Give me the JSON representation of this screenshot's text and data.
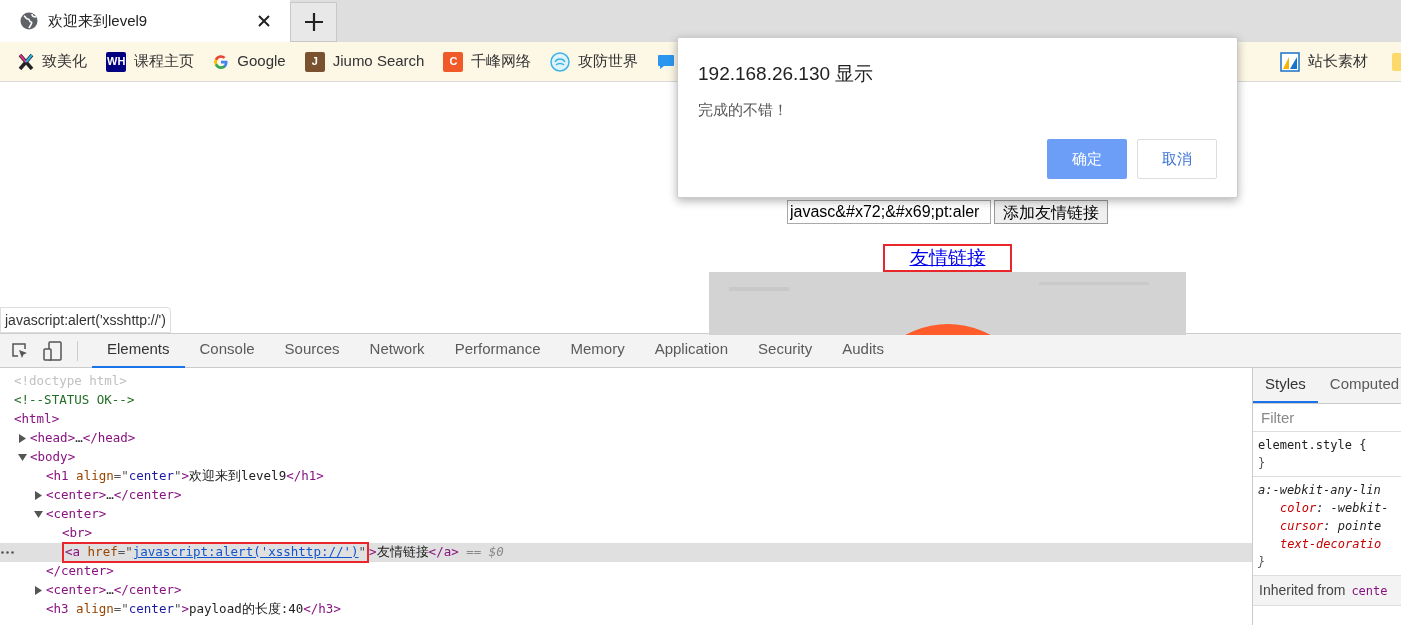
{
  "browser": {
    "tabs": [
      {
        "title": "欢迎来到level9",
        "selected": true
      }
    ],
    "bookmarks_left": [
      {
        "label": "致美化",
        "kind": "x-logo"
      },
      {
        "label": "课程主页",
        "kind": "letter",
        "glyph": "WH",
        "color": "#000080"
      },
      {
        "label": "Google",
        "kind": "google"
      },
      {
        "label": "Jiumo Search",
        "kind": "letter",
        "glyph": "J",
        "color": "#7a5230"
      },
      {
        "label": "千峰网络",
        "kind": "letter",
        "glyph": "C",
        "color": "#f05a28"
      },
      {
        "label": "攻防世界",
        "kind": "swirl"
      },
      {
        "kind": "chat"
      }
    ],
    "bookmarks_right": [
      {
        "label": "站长素材",
        "kind": "tiles"
      },
      {
        "kind": "folder"
      }
    ]
  },
  "page": {
    "input_value": "javasc&#x72;&#x69;pt:aler",
    "button": "添加友情链接",
    "link": "友情链接",
    "status_tooltip": "javascript:alert('xsshttp://')"
  },
  "dialog": {
    "title": "192.168.26.130 显示",
    "message": "完成的不错！",
    "buttons": [
      {
        "label": "确定",
        "kind": "primary"
      },
      {
        "label": "取消",
        "kind": "secondary"
      }
    ]
  },
  "devtools": {
    "tabs": [
      {
        "label": "Elements",
        "selected": true
      },
      {
        "label": "Console",
        "selected": false
      },
      {
        "label": "Sources",
        "selected": false
      },
      {
        "label": "Network",
        "selected": false
      },
      {
        "label": "Performance",
        "selected": false
      },
      {
        "label": "Memory",
        "selected": false
      },
      {
        "label": "Application",
        "selected": false
      },
      {
        "label": "Security",
        "selected": false
      },
      {
        "label": "Audits",
        "selected": false
      }
    ],
    "tree": [
      {
        "selected": false,
        "parts": [
          {
            "kind": "doctype",
            "text": "<!doctype html>"
          }
        ]
      },
      {
        "selected": false,
        "parts": [
          {
            "kind": "comment",
            "text": "<!--STATUS OK-->"
          }
        ]
      },
      {
        "selected": false,
        "parts": [
          {
            "kind": "tag",
            "text": "<html>"
          }
        ],
        "children": [
          {
            "selected": false,
            "expanded": false,
            "parts": [
              {
                "kind": "tag",
                "text": "<head>"
              },
              {
                "kind": "text",
                "text": "…"
              },
              {
                "kind": "tag",
                "text": "</head>"
              }
            ]
          },
          {
            "selected": false,
            "expanded": true,
            "parts": [
              {
                "kind": "tag",
                "text": "<body>"
              }
            ],
            "children": [
              {
                "selected": false,
                "parts": [
                  {
                    "kind": "tag",
                    "text": "<h1"
                  },
                  {
                    "kind": "attr",
                    "text": " align"
                  },
                  {
                    "kind": "punct",
                    "text": "=\""
                  },
                  {
                    "kind": "value",
                    "text": "center"
                  },
                  {
                    "kind": "punct",
                    "text": "\""
                  },
                  {
                    "kind": "tag",
                    "text": ">"
                  },
                  {
                    "kind": "text",
                    "text": "欢迎来到level9"
                  },
                  {
                    "kind": "tag",
                    "text": "</h1>"
                  }
                ]
              },
              {
                "selected": false,
                "expanded": false,
                "parts": [
                  {
                    "kind": "tag",
                    "text": "<center>"
                  },
                  {
                    "kind": "text",
                    "text": "…"
                  },
                  {
                    "kind": "tag",
                    "text": "</center>"
                  }
                ]
              },
              {
                "selected": false,
                "expanded": true,
                "parts": [
                  {
                    "kind": "tag",
                    "text": "<center>"
                  }
                ],
                "end": [
                  {
                    "kind": "tag",
                    "text": "</center>"
                  }
                ],
                "children": [
                  {
                    "selected": false,
                    "parts": [
                      {
                        "kind": "tag",
                        "text": "<br>"
                      }
                    ]
                  },
                  {
                    "selected": true,
                    "boxed_parts": [
                      {
                        "kind": "tag",
                        "text": "<a"
                      },
                      {
                        "kind": "attr",
                        "text": " href"
                      },
                      {
                        "kind": "punct",
                        "text": "=\""
                      },
                      {
                        "kind": "link",
                        "text": "javascript:alert('xsshttp://')"
                      },
                      {
                        "kind": "punct",
                        "text": "\""
                      }
                    ],
                    "parts": [
                      {
                        "kind": "tag",
                        "text": ">"
                      },
                      {
                        "kind": "text",
                        "text": "友情链接"
                      },
                      {
                        "kind": "tag",
                        "text": "</a>"
                      },
                      {
                        "kind": "ref",
                        "text": " == $0"
                      }
                    ]
                  }
                ]
              },
              {
                "selected": false,
                "expanded": false,
                "parts": [
                  {
                    "kind": "tag",
                    "text": "<center>"
                  },
                  {
                    "kind": "text",
                    "text": "…"
                  },
                  {
                    "kind": "tag",
                    "text": "</center>"
                  }
                ]
              },
              {
                "selected": false,
                "parts": [
                  {
                    "kind": "tag",
                    "text": "<h3"
                  },
                  {
                    "kind": "attr",
                    "text": " align"
                  },
                  {
                    "kind": "punct",
                    "text": "=\""
                  },
                  {
                    "kind": "value",
                    "text": "center"
                  },
                  {
                    "kind": "punct",
                    "text": "\""
                  },
                  {
                    "kind": "tag",
                    "text": ">"
                  },
                  {
                    "kind": "text",
                    "text": "payload的长度:40"
                  },
                  {
                    "kind": "tag",
                    "text": "</h3>"
                  }
                ]
              }
            ]
          }
        ]
      }
    ],
    "styles": {
      "tabs": [
        {
          "label": "Styles",
          "selected": true
        },
        {
          "label": "Computed",
          "selected": false
        }
      ],
      "filter_placeholder": "Filter",
      "rules": [
        {
          "kind": "inline",
          "selector": "element.style {",
          "close": "}"
        },
        {
          "kind": "user-agent",
          "selector": "a:-webkit-any-lin",
          "declarations": [
            {
              "property": "color",
              "separator": ": ",
              "value": "-webkit-"
            },
            {
              "property": "cursor",
              "separator": ": ",
              "value": "pointe"
            },
            {
              "property": "text-decoratio"
            }
          ],
          "close": "}"
        }
      ],
      "inherited": {
        "label": "Inherited from",
        "selector": "cente"
      }
    }
  }
}
